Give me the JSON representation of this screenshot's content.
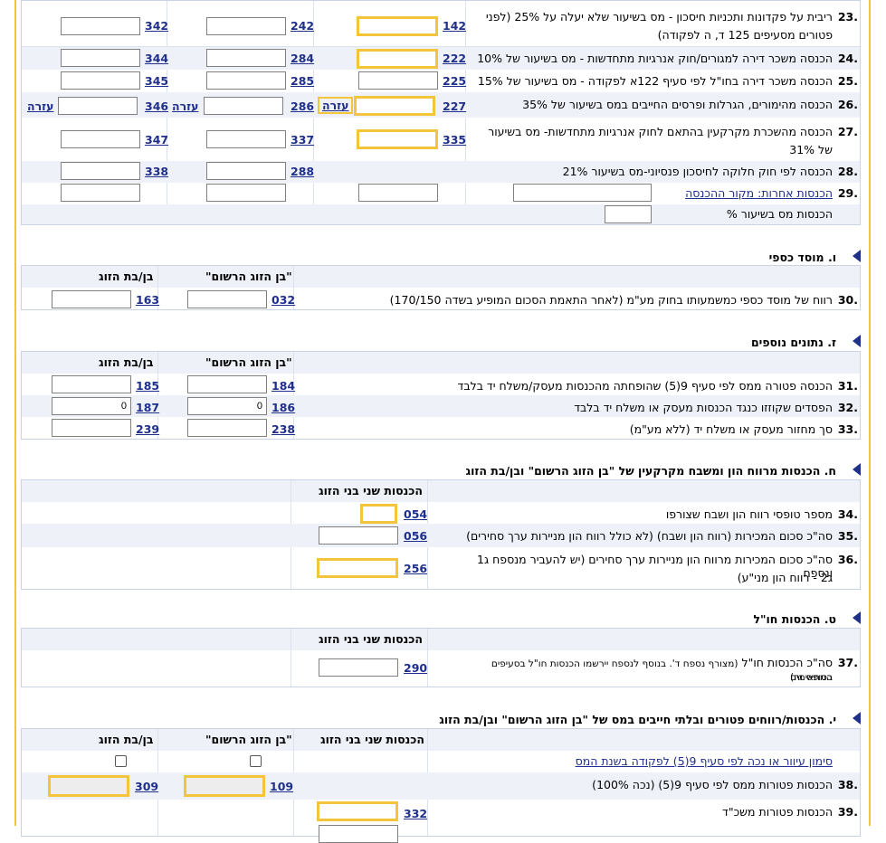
{
  "sectionV_rows": [
    {
      "num": "23.",
      "text": "ריבית על פקדונות ותכניות חיסכון - מס בשיעור שלא יעלה על 25% (לפני",
      "text2": "פטורים מסעיפים 125 ד, ה לפקודה)",
      "codes": [
        "142",
        "242",
        "342"
      ]
    },
    {
      "num": "24.",
      "text": "הכנסה משכר דירה למגורים/חוק אנרגיות מתחדשות - מס בשיעור של 10%",
      "codes": [
        "222",
        "284",
        "344"
      ]
    },
    {
      "num": "25.",
      "text": "הכנסה משכר דירה בחו\"ל לפי סעיף 122א לפקודה - מס בשיעור של 15%",
      "codes": [
        "225",
        "285",
        "345"
      ]
    },
    {
      "num": "26.",
      "text": "הכנסה מהימורים, הגרלות ופרסים החייבים במס בשיעור של 35%",
      "codes": [
        "227",
        "286",
        "346"
      ],
      "help": "עזרה"
    },
    {
      "num": "27.",
      "text": "הכנסה מהשכרת מקרקעין בהתאם לחוק אנרגיות מתחדשות- מס בשיעור",
      "text2": "של 31%",
      "codes": [
        "335",
        "337",
        "347"
      ]
    },
    {
      "num": "28.",
      "text": "הכנסה לפי חוק חלוקה לחיסכון פנסיוני-מס בשיעור 21%",
      "codes": [
        "",
        "288",
        "338"
      ]
    },
    {
      "num": "29.",
      "text": "הכנסות אחרות: מקור ההכנסה"
    },
    {
      "text": "הכנסות מס בשיעור %"
    }
  ],
  "sectionVav": {
    "title": "ו. מוסד כספי",
    "col_registered": "\"בן הזוג הרשום\"",
    "col_spouse": "בן/בת הזוג",
    "rows": [
      {
        "num": "30.",
        "text": "רווח של מוסד כספי כמשמעותו בחוק מע\"מ (לאחר התאמת הסכום המופיע בשדה 170/150)",
        "codes": [
          "032",
          "163"
        ]
      }
    ]
  },
  "sectionZayin": {
    "title": "ז. נתונים נוספים",
    "col_registered": "\"בן הזוג הרשום\"",
    "col_spouse": "בן/בת הזוג",
    "rows": [
      {
        "num": "31.",
        "text": "הכנסה פטורה ממס לפי סעיף 9(5) שהופחתה מהכנסות מעסק/משלח יד בלבד",
        "codes": [
          "184",
          "185"
        ],
        "values": [
          "",
          ""
        ]
      },
      {
        "num": "32.",
        "text": "הפסדים שקוזזו כנגד הכנסות מעסק או משלח יד בלבד",
        "codes": [
          "186",
          "187"
        ],
        "values": [
          "0",
          "0"
        ]
      },
      {
        "num": "33.",
        "text": "סך מחזור מעסק או משלח יד (ללא מע\"מ)",
        "codes": [
          "238",
          "239"
        ],
        "values": [
          "",
          ""
        ]
      }
    ]
  },
  "sectionChet": {
    "title": "ח. הכנסות מרווח הון ומשבח מקרקעין של \"בן הזוג הרשום\" ובן/בת הזוג",
    "col_both": "הכנסות שני בני הזוג",
    "rows": [
      {
        "num": "34.",
        "text": "מספר טופסי רווח הון ושבח שצורפו",
        "code": "054"
      },
      {
        "num": "35.",
        "text": "סה\"כ סכום המכירות (רווח הון ושבח) (לא כולל רווח הון מניירות ערך סחירים)",
        "code": "056"
      },
      {
        "num": "36.",
        "text": "סה\"כ סכום המכירות מרווח הון מניירות ערך סחירים (יש להעביר מנספח ג1 ונספח",
        "text2": "ג2 - רווח הון מני\"ע)",
        "code": "256"
      }
    ]
  },
  "sectionTet": {
    "title": "ט. הכנסות חו\"ל",
    "col_both": "הכנסות שני בני הזוג",
    "rows": [
      {
        "num": "37.",
        "text": "סה\"כ הכנסות חו\"ל",
        "small": "(מצורף נספח ד'. בנוסף לנספח יירשמו הכנסות חו\"ל בסעיפים המתאימים",
        "small2": "בטופס זה)",
        "code": "290"
      }
    ]
  },
  "sectionYud": {
    "title": "י. הכנסות/רווחים פטורים ובלתי חייבים במס של \"בן הזוג הרשום\" ובן/בת הזוג",
    "col_both": "הכנסות שני בני הזוג",
    "col_registered": "\"בן הזוג הרשום\"",
    "col_spouse": "בן/בת הזוג",
    "checkbox_label": "סימון עיוור או נכה לפי סעיף 9(5) לפקודה בשנת המס",
    "rows": [
      {
        "num": "38.",
        "text": "הכנסות פטורות ממס לפי סעיף 9(5) (נכה 100%)",
        "codes": [
          "109",
          "309"
        ]
      },
      {
        "num": "39.",
        "text": "הכנסות פטורות משכ\"ד",
        "code": "332"
      }
    ]
  },
  "colors": {
    "accent": "#f3c53c",
    "link": "#1f2f8c",
    "border": "#c9d3e3",
    "header_bg": "#eef2f8"
  }
}
